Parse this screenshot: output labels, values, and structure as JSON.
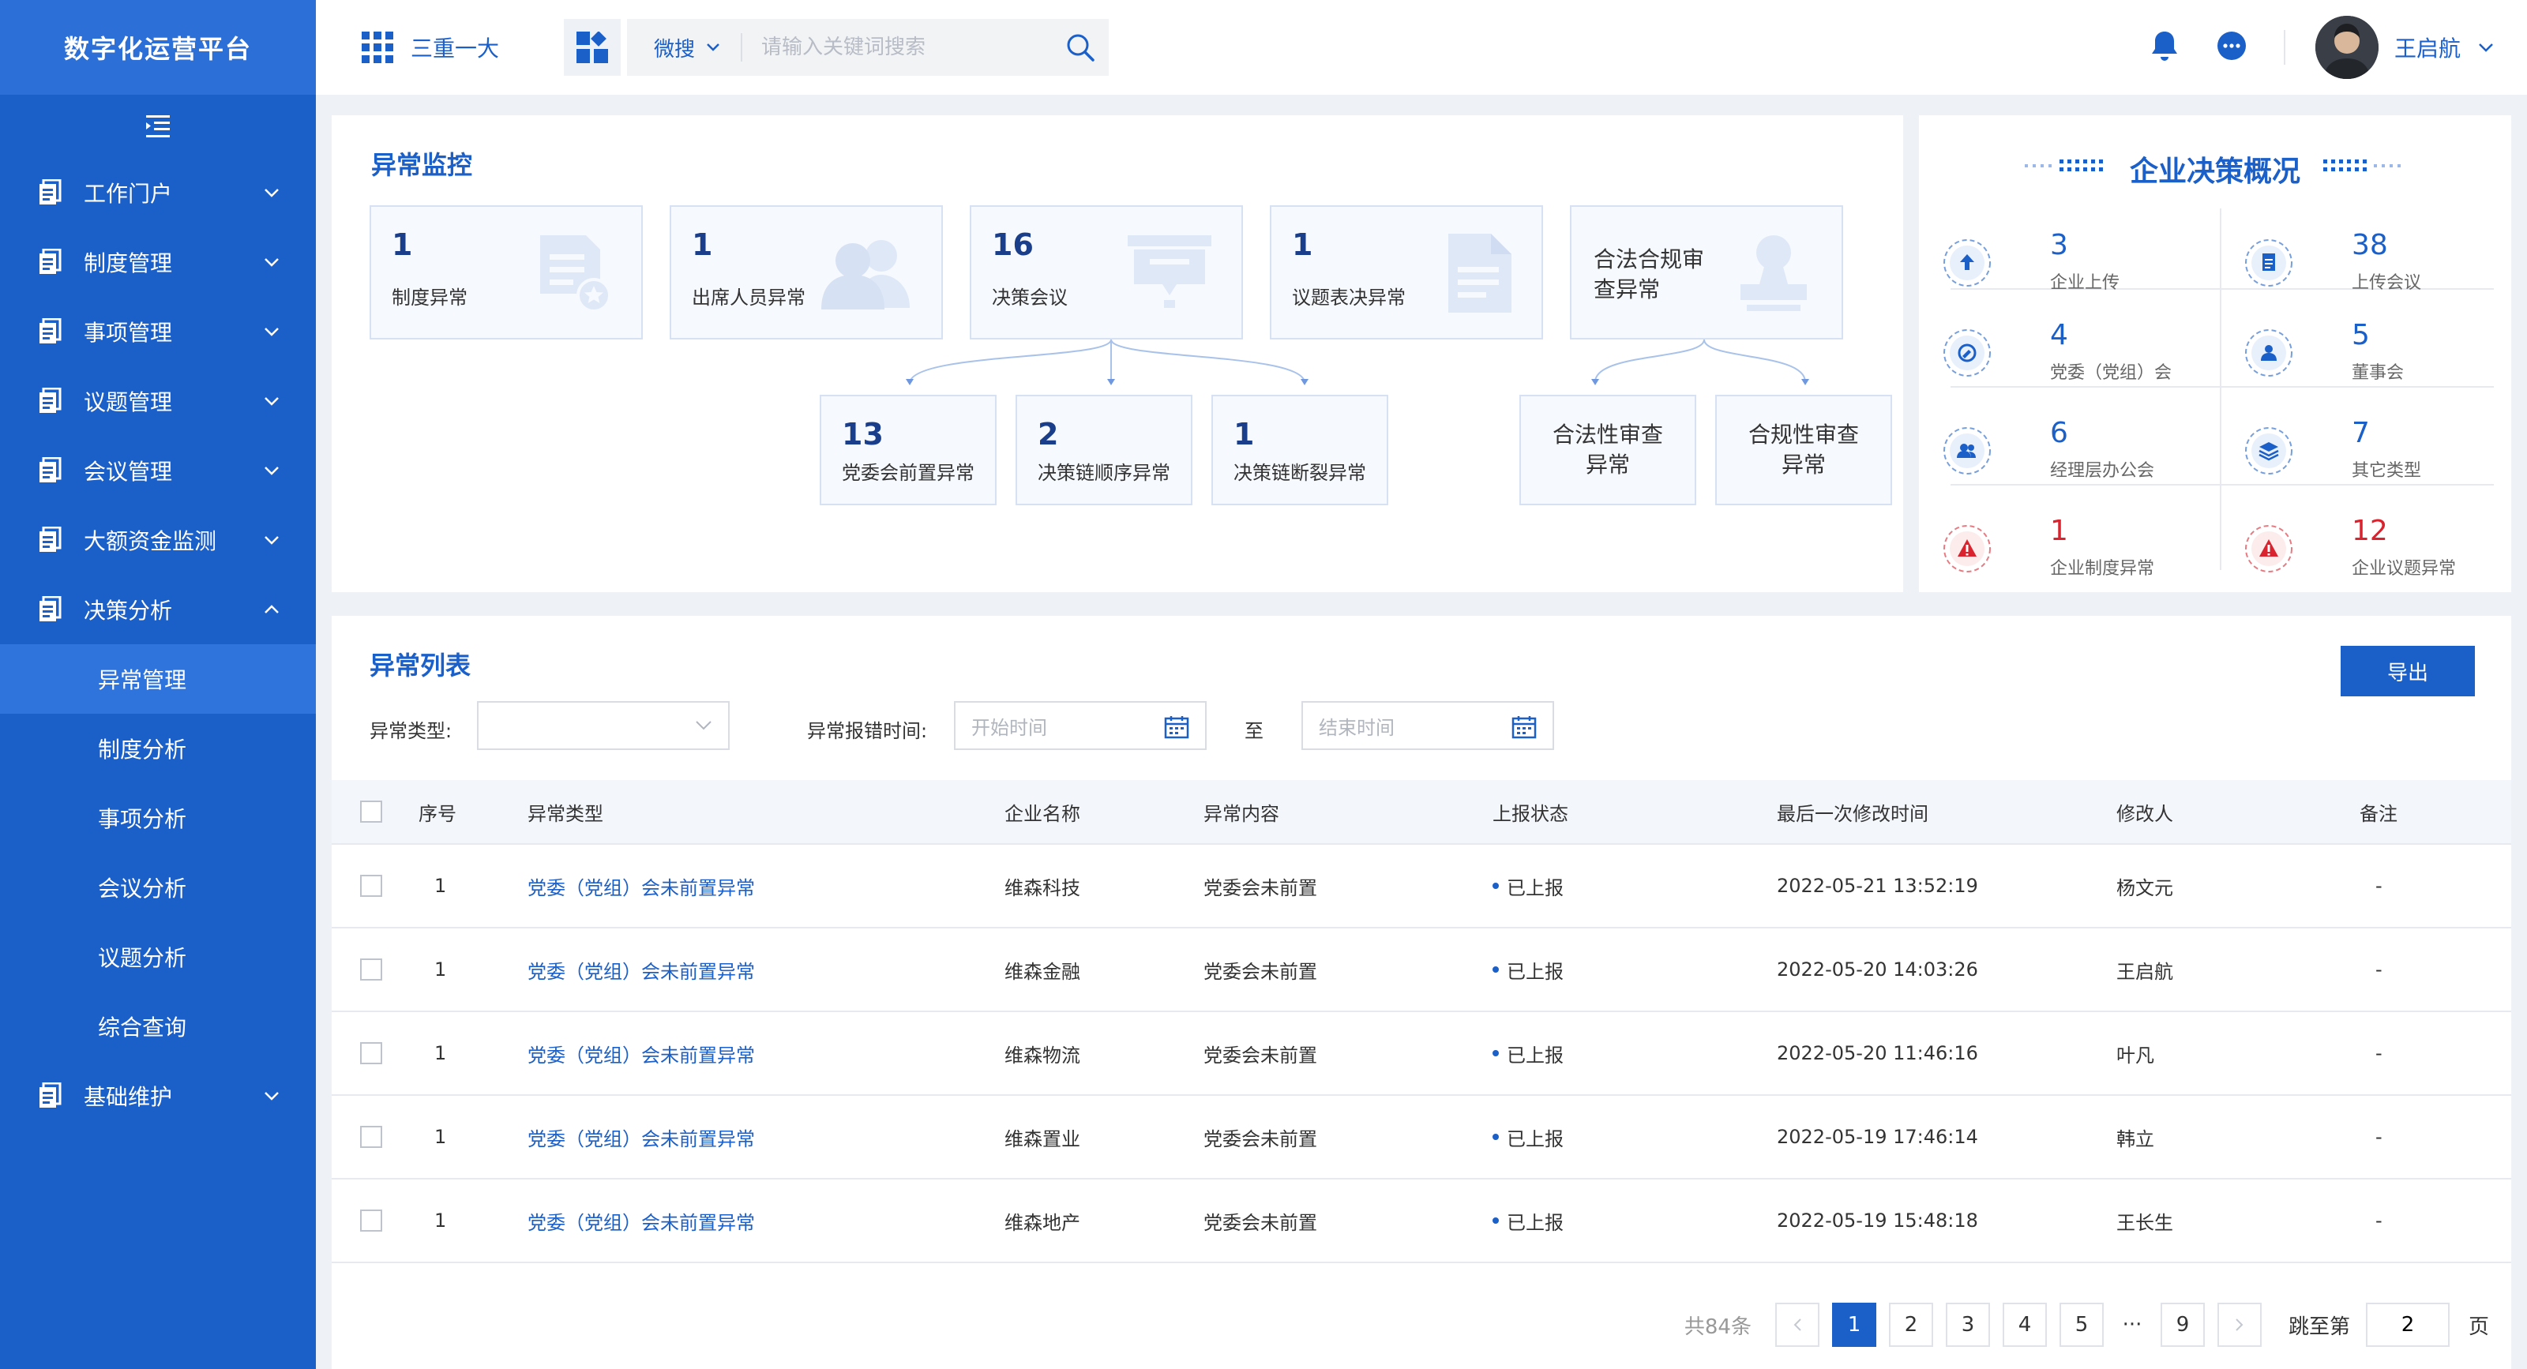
{
  "brand": "数字化运营平台",
  "colors": {
    "primary": "#1b5fc8",
    "alert": "#d9232e"
  },
  "sidebar": {
    "items": [
      {
        "label": "工作门户",
        "icon": "document-icon"
      },
      {
        "label": "制度管理",
        "icon": "document-icon"
      },
      {
        "label": "事项管理",
        "icon": "document-icon"
      },
      {
        "label": "议题管理",
        "icon": "document-icon"
      },
      {
        "label": "会议管理",
        "icon": "document-icon"
      },
      {
        "label": "大额资金监测",
        "icon": "document-icon"
      },
      {
        "label": "决策分析",
        "icon": "document-icon",
        "expanded": true
      },
      {
        "label": "基础维护",
        "icon": "document-icon"
      }
    ],
    "subitems": [
      {
        "label": "异常管理",
        "active": true
      },
      {
        "label": "制度分析"
      },
      {
        "label": "事项分析"
      },
      {
        "label": "会议分析"
      },
      {
        "label": "议题分析"
      },
      {
        "label": "综合查询"
      }
    ]
  },
  "header": {
    "app_label": "三重一大",
    "search_scope": "微搜",
    "search_placeholder": "请输入关键词搜索",
    "user_name": "王启航"
  },
  "monitor": {
    "title": "异常监控",
    "cards_top": [
      {
        "num": "1",
        "label": "制度异常",
        "icon": "document-star-icon"
      },
      {
        "num": "1",
        "label": "出席人员异常",
        "icon": "users-icon"
      },
      {
        "num": "16",
        "label": "决策会议",
        "icon": "presentation-icon"
      },
      {
        "num": "1",
        "label": "议题表决异常",
        "icon": "file-icon"
      }
    ],
    "legal_card": {
      "label": "合法合规审查异常",
      "icon": "stamp-icon"
    },
    "cards_sub": [
      {
        "num": "13",
        "label": "党委会前置异常"
      },
      {
        "num": "2",
        "label": "决策链顺序异常"
      },
      {
        "num": "1",
        "label": "决策链断裂异常"
      }
    ],
    "legal_sub": [
      {
        "label": "合法性审查异常"
      },
      {
        "label": "合规性审查异常"
      }
    ]
  },
  "summary": {
    "title": "企业决策概况",
    "stats": [
      {
        "value": "3",
        "label": "企业上传",
        "icon": "upload-icon"
      },
      {
        "value": "38",
        "label": "上传会议",
        "icon": "document-icon"
      },
      {
        "value": "4",
        "label": "党委（党组）会",
        "icon": "party-icon"
      },
      {
        "value": "5",
        "label": "董事会",
        "icon": "user-icon"
      },
      {
        "value": "6",
        "label": "经理层办公会",
        "icon": "group-icon"
      },
      {
        "value": "7",
        "label": "其它类型",
        "icon": "layers-icon"
      },
      {
        "value": "1",
        "label": "企业制度异常",
        "icon": "warning-icon"
      },
      {
        "value": "12",
        "label": "企业议题异常",
        "icon": "warning-icon"
      }
    ]
  },
  "list": {
    "title": "异常列表",
    "export_label": "导出",
    "filters": {
      "type_label": "异常类型:",
      "time_label": "异常报错时间:",
      "start_placeholder": "开始时间",
      "to_label": "至",
      "end_placeholder": "结束时间"
    },
    "columns": [
      "序号",
      "异常类型",
      "企业名称",
      "异常内容",
      "上报状态",
      "最后一次修改时间",
      "修改人",
      "备注"
    ],
    "rows": [
      {
        "no": "1",
        "type": "党委（党组）会未前置异常",
        "company": "维森科技",
        "content": "党委会未前置",
        "status": "已上报",
        "time": "2022-05-21 13:52:19",
        "editor": "杨文元",
        "note": "-"
      },
      {
        "no": "1",
        "type": "党委（党组）会未前置异常",
        "company": "维森金融",
        "content": "党委会未前置",
        "status": "已上报",
        "time": "2022-05-20 14:03:26",
        "editor": "王启航",
        "note": "-"
      },
      {
        "no": "1",
        "type": "党委（党组）会未前置异常",
        "company": "维森物流",
        "content": "党委会未前置",
        "status": "已上报",
        "time": "2022-05-20 11:46:16",
        "editor": "叶凡",
        "note": "-"
      },
      {
        "no": "1",
        "type": "党委（党组）会未前置异常",
        "company": "维森置业",
        "content": "党委会未前置",
        "status": "已上报",
        "time": "2022-05-19 17:46:14",
        "editor": "韩立",
        "note": "-"
      },
      {
        "no": "1",
        "type": "党委（党组）会未前置异常",
        "company": "维森地产",
        "content": "党委会未前置",
        "status": "已上报",
        "time": "2022-05-19 15:48:18",
        "editor": "王长生",
        "note": "-"
      }
    ],
    "pagination": {
      "total": "共84条",
      "pages": [
        "1",
        "2",
        "3",
        "4",
        "5"
      ],
      "ellipsis": "···",
      "last": "9",
      "current": "1",
      "jump_label": "跳至第",
      "jump_value": "2",
      "unit": "页"
    }
  }
}
